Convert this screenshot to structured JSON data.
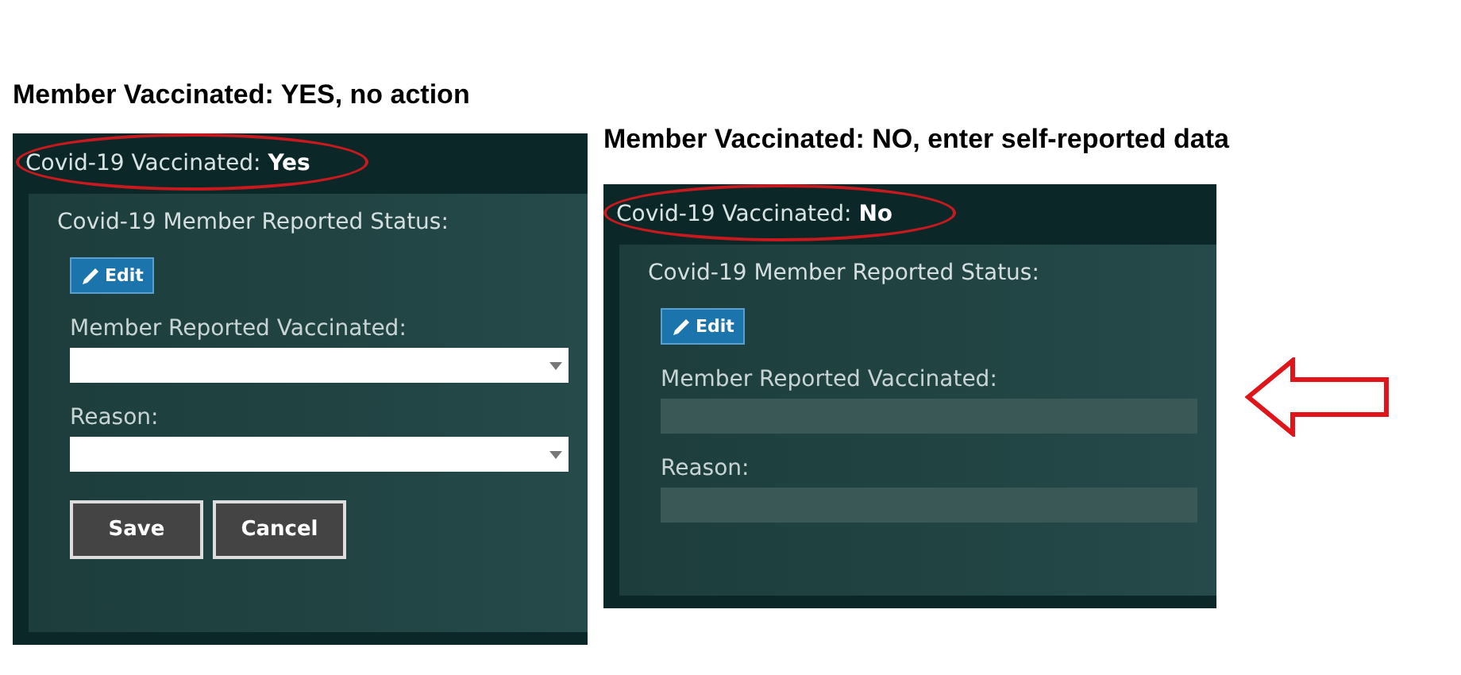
{
  "panels": [
    {
      "caption": "Member Vaccinated: YES, no action",
      "status_label": "Covid-19 Vaccinated:",
      "status_value": "Yes",
      "section_title": "Covid-19 Member Reported Status:",
      "edit_button": "Edit",
      "fields": [
        {
          "label": "Member Reported Vaccinated:",
          "disabled": false
        },
        {
          "label": "Reason:",
          "disabled": false
        }
      ],
      "buttons": [
        "Save",
        "Cancel"
      ],
      "arrow": false
    },
    {
      "caption": "Member Vaccinated: NO, enter self-reported data",
      "status_label": "Covid-19 Vaccinated:",
      "status_value": "No",
      "section_title": "Covid-19 Member Reported Status:",
      "edit_button": "Edit",
      "fields": [
        {
          "label": "Member Reported Vaccinated:",
          "disabled": true
        },
        {
          "label": "Reason:",
          "disabled": true
        }
      ],
      "arrow": true
    }
  ]
}
